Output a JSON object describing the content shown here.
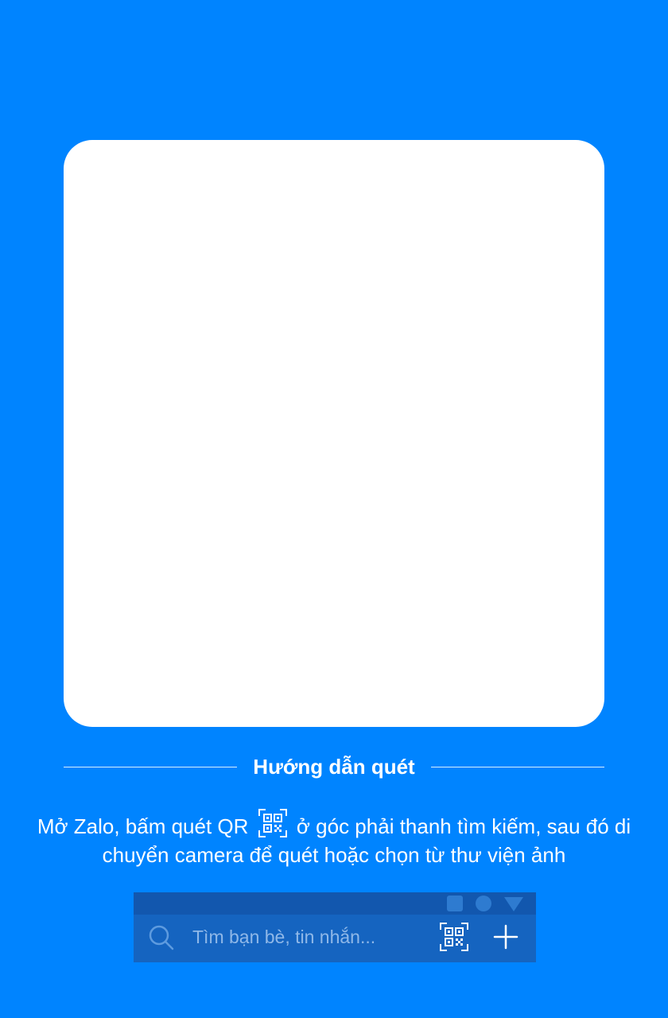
{
  "guide": {
    "title": "Hướng dẫn quét"
  },
  "instructions": {
    "part1": "Mở Zalo, bấm quét QR",
    "part2": "ở góc phải thanh tìm kiếm, sau đó di chuyển camera để quét hoặc chọn từ thư viện ảnh",
    "inline_icon": "qr-scan-icon"
  },
  "zalo_bar": {
    "search_placeholder": "Tìm bạn bè, tin nhắn...",
    "icons": [
      "search-icon",
      "qr-scan-icon",
      "plus-icon"
    ],
    "status_icons": [
      "square-icon",
      "circle-icon",
      "triangle-icon"
    ]
  },
  "colors": {
    "background": "#0084FF",
    "card": "#FFFFFF",
    "bar": "#1564C0",
    "bar_status": "#1257AE"
  }
}
